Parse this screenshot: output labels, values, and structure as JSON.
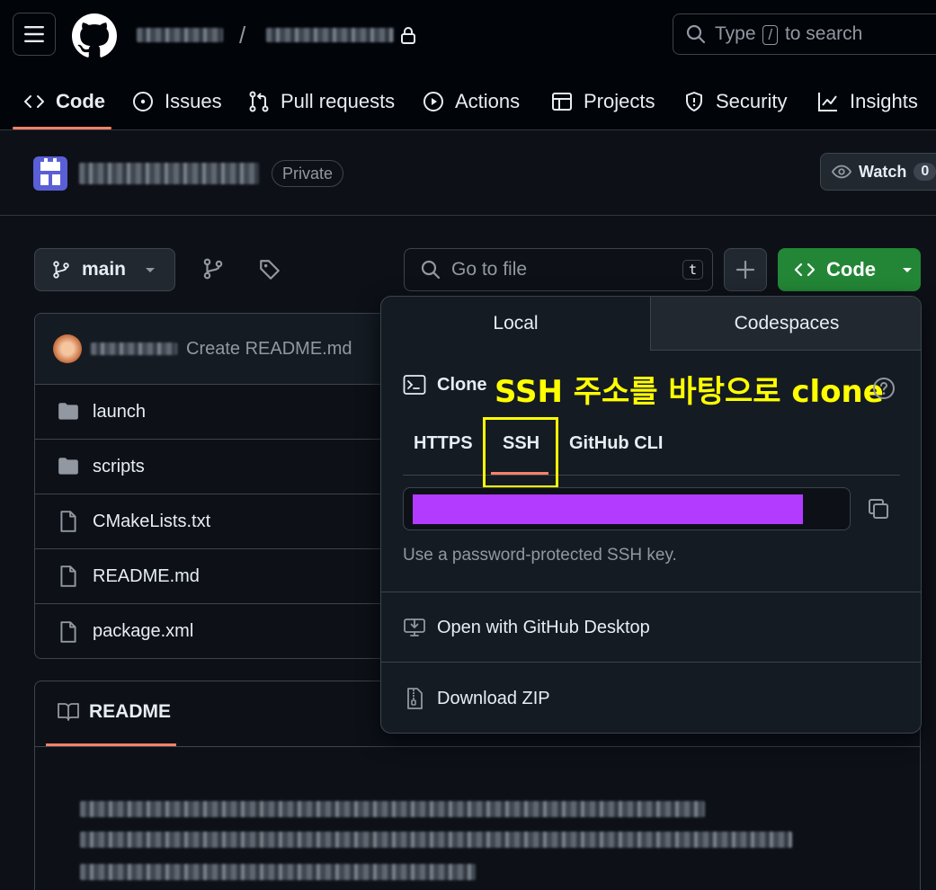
{
  "header": {
    "search_prefix": "Type",
    "search_key": "/",
    "search_suffix": "to search",
    "path_separator": "/"
  },
  "nav": {
    "code": "Code",
    "issues": "Issues",
    "pull_requests": "Pull requests",
    "actions": "Actions",
    "projects": "Projects",
    "security": "Security",
    "insights": "Insights"
  },
  "repo": {
    "visibility": "Private",
    "watch_label": "Watch",
    "watch_count": "0"
  },
  "toolbar": {
    "branch": "main",
    "goto_placeholder": "Go to file",
    "goto_key": "t",
    "code_label": "Code"
  },
  "files": {
    "commit_message": "Create README.md",
    "items": [
      {
        "name": "launch",
        "type": "folder"
      },
      {
        "name": "scripts",
        "type": "folder"
      },
      {
        "name": "CMakeLists.txt",
        "type": "file"
      },
      {
        "name": "README.md",
        "type": "file"
      },
      {
        "name": "package.xml",
        "type": "file"
      }
    ]
  },
  "readme": {
    "title": "README"
  },
  "clone_panel": {
    "tab_local": "Local",
    "tab_codespaces": "Codespaces",
    "clone_title": "Clone",
    "annotation": "SSH 주소를 바탕으로 clone",
    "protocols": [
      "HTTPS",
      "SSH",
      "GitHub CLI"
    ],
    "selected_protocol": "SSH",
    "hint": "Use a password-protected SSH key.",
    "open_desktop": "Open with GitHub Desktop",
    "download_zip": "Download ZIP"
  },
  "colors": {
    "background": "#0d1117",
    "accent_underline": "#f78166",
    "code_button": "#238636",
    "annotation": "#ffff00",
    "redaction": "#b23bff"
  }
}
